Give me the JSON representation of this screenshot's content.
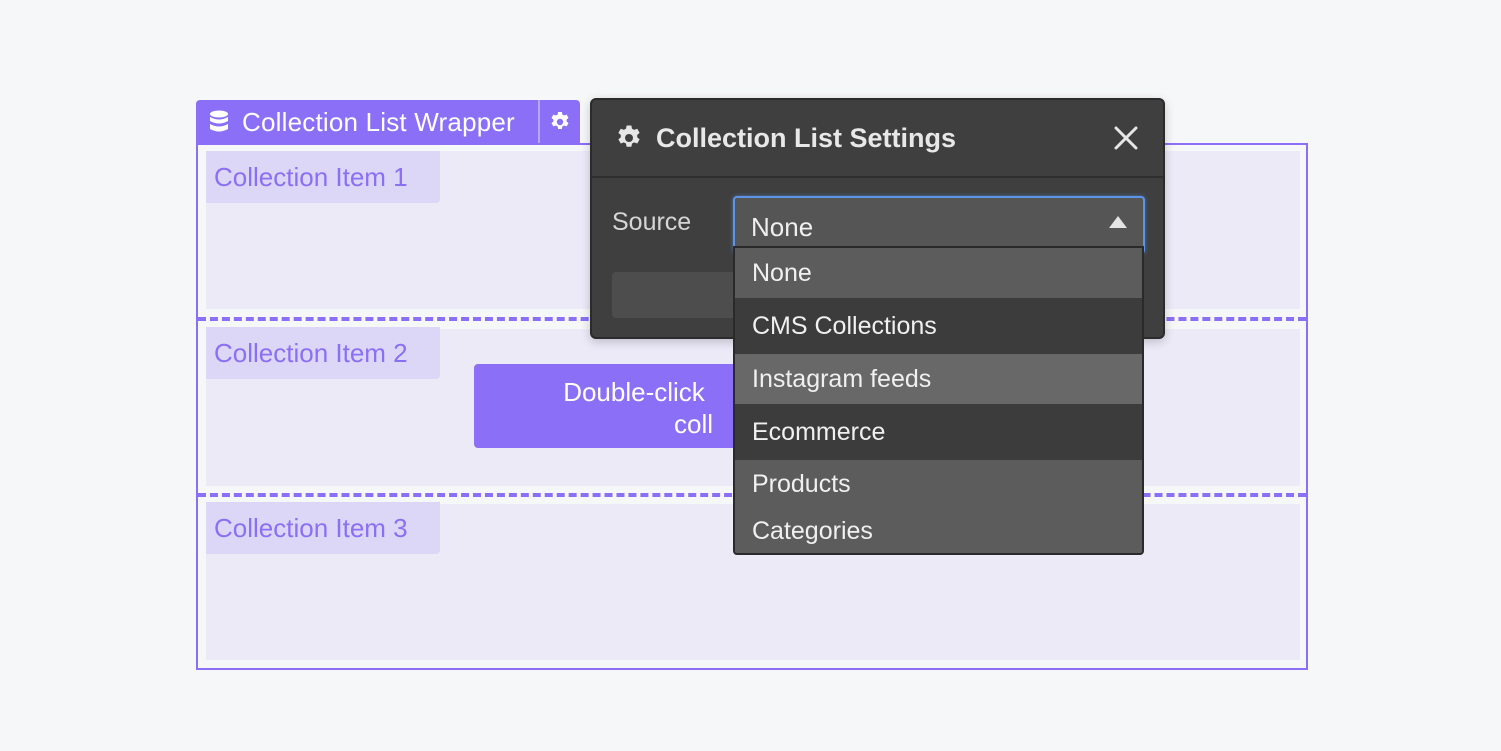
{
  "wrapper": {
    "title": "Collection List Wrapper",
    "icon": "database-icon",
    "settings_icon": "gear-icon"
  },
  "items": [
    {
      "label": "Collection Item 1"
    },
    {
      "label": "Collection Item 2"
    },
    {
      "label": "Collection Item 3"
    }
  ],
  "placeholder_button": {
    "line1": "Double-click",
    "line2": "coll"
  },
  "dialog": {
    "title": "Collection List Settings",
    "source_label": "Source",
    "selected_value": "None"
  },
  "dropdown": {
    "options": [
      "None",
      "CMS Collections",
      "Instagram feeds",
      "Ecommerce",
      "Products",
      "Categories"
    ]
  },
  "colors": {
    "accent": "#8b6ff7",
    "item_bg": "#edeaf8",
    "dialog_bg": "#3f3f3f",
    "focus": "#5d94e8"
  }
}
